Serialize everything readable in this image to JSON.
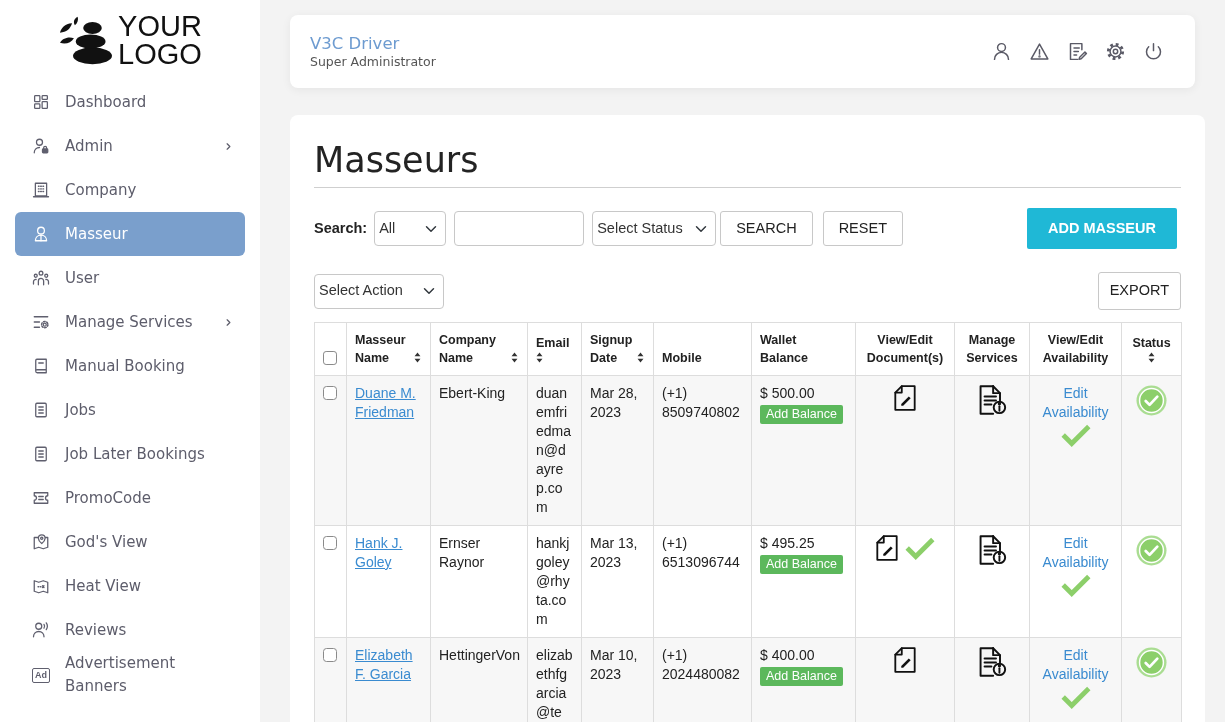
{
  "sidebar": {
    "logo": {
      "text": "YOUR LOGO"
    },
    "items": [
      {
        "label": "Dashboard",
        "selected": false,
        "has_submenu": false
      },
      {
        "label": "Admin",
        "selected": false,
        "has_submenu": true
      },
      {
        "label": "Company",
        "selected": false,
        "has_submenu": false
      },
      {
        "label": "Masseur",
        "selected": true,
        "has_submenu": false
      },
      {
        "label": "User",
        "selected": false,
        "has_submenu": false
      },
      {
        "label": "Manage Services",
        "selected": false,
        "has_submenu": true
      },
      {
        "label": "Manual Booking",
        "selected": false,
        "has_submenu": false
      },
      {
        "label": "Jobs",
        "selected": false,
        "has_submenu": false
      },
      {
        "label": "Job Later Bookings",
        "selected": false,
        "has_submenu": false
      },
      {
        "label": "PromoCode",
        "selected": false,
        "has_submenu": false
      },
      {
        "label": "God's View",
        "selected": false,
        "has_submenu": false
      },
      {
        "label": "Heat View",
        "selected": false,
        "has_submenu": false
      },
      {
        "label": "Reviews",
        "selected": false,
        "has_submenu": false
      },
      {
        "label": "Advertisement Banners",
        "selected": false,
        "has_submenu": false,
        "icon_text": "Ad"
      }
    ]
  },
  "header": {
    "title": "V3C Driver",
    "subtitle": "Super Administrator"
  },
  "page": {
    "title": "Masseurs",
    "search_label": "Search:",
    "search_scope": "All",
    "status_filter": "Select Status",
    "search_button": "SEARCH",
    "reset_button": "RESET",
    "add_button": "ADD MASSEUR",
    "bulk_action": "Select Action",
    "export_button": "EXPORT"
  },
  "table": {
    "select_all": {
      "checked": false
    },
    "columns": [
      {
        "label": "Masseur Name",
        "sortable": true
      },
      {
        "label": "Company Name",
        "sortable": true
      },
      {
        "label": "Email",
        "sortable": true
      },
      {
        "label": "Signup Date",
        "sortable": true
      },
      {
        "label": "Mobile",
        "sortable": false
      },
      {
        "label": "Wallet Balance",
        "sortable": false
      },
      {
        "label": "View/Edit Document(s)",
        "sortable": false
      },
      {
        "label": "Manage Services",
        "sortable": false
      },
      {
        "label": "View/Edit Availability",
        "sortable": false
      },
      {
        "label": "Status",
        "sortable": true
      }
    ],
    "rows": [
      {
        "checked": false,
        "name": "Duane M. Friedman",
        "company": "Ebert-King",
        "email": "duanemfriedman@dayrep.com",
        "signup_date": "Mar 28, 2023",
        "mobile": "(+1) 8509740802",
        "wallet_balance": "$ 500.00",
        "add_balance": "Add Balance",
        "documents_verified": false,
        "edit_availability": "Edit Availability",
        "availability_set": true,
        "active": true
      },
      {
        "checked": false,
        "name": "Hank J. Goley",
        "company": "Ernser Raynor",
        "email": "hankjgoley@rhyta.com",
        "signup_date": "Mar 13, 2023",
        "mobile": "(+1) 6513096744",
        "wallet_balance": "$ 495.25",
        "add_balance": "Add Balance",
        "documents_verified": true,
        "edit_availability": "Edit Availability",
        "availability_set": true,
        "active": true
      },
      {
        "checked": false,
        "name": "Elizabeth F. Garcia",
        "company": "HettingerVon",
        "email": "elizabethfgarcia@te",
        "signup_date": "Mar 10, 2023",
        "mobile": "(+1) 2024480082",
        "wallet_balance": "$ 400.00",
        "add_balance": "Add Balance",
        "documents_verified": false,
        "edit_availability": "Edit Availability",
        "availability_set": true,
        "active": true
      }
    ]
  }
}
